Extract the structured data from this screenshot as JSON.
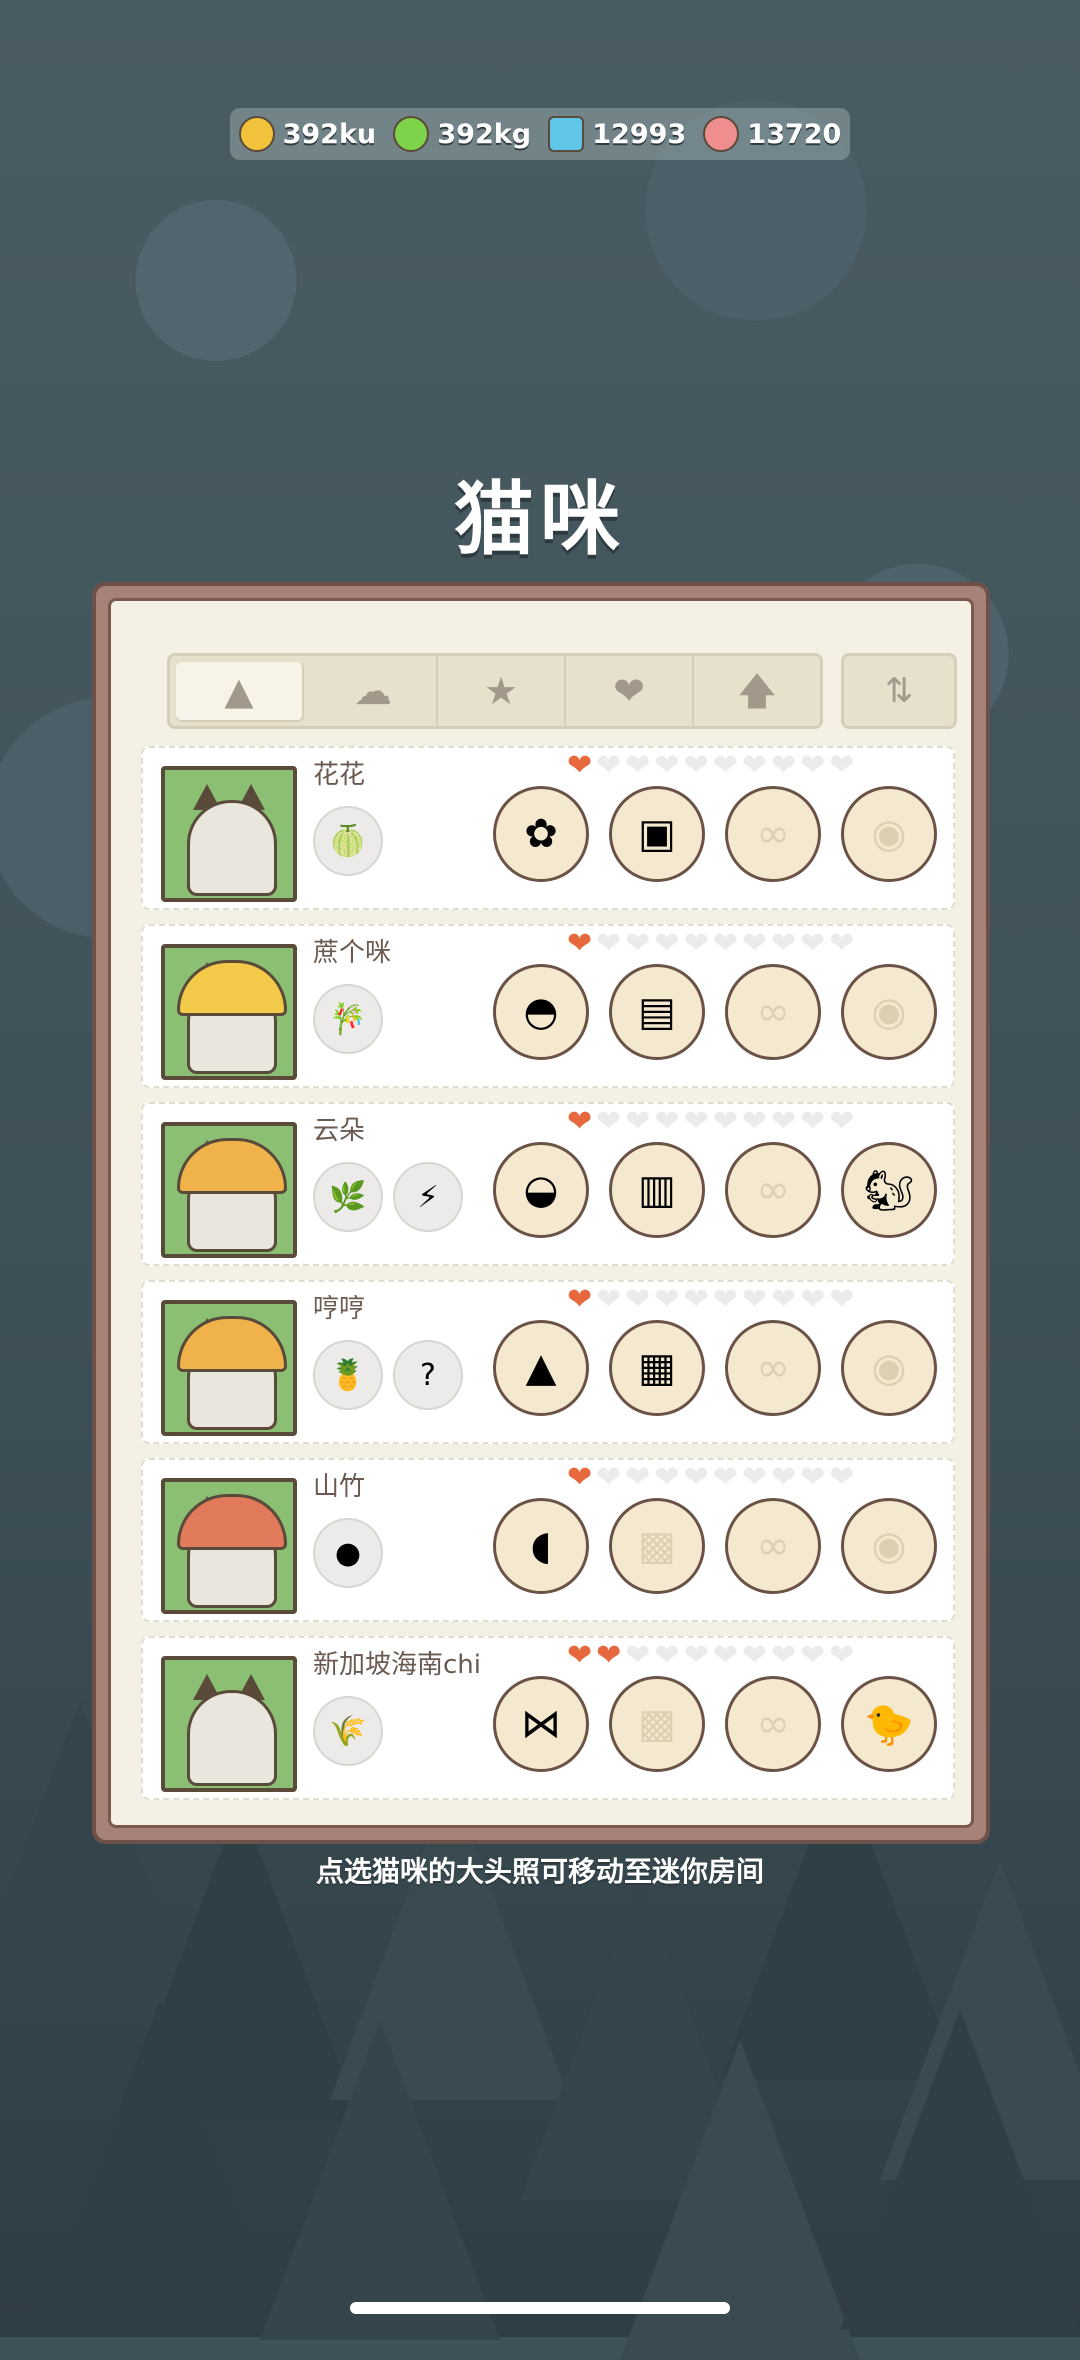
{
  "currency": [
    {
      "icon": "coin-icon",
      "value": "392ku",
      "color": "#f2c23c"
    },
    {
      "icon": "energy-icon",
      "value": "392kg",
      "color": "#7fd34b"
    },
    {
      "icon": "gem-icon",
      "value": "12993",
      "color": "#5fc6e8"
    },
    {
      "icon": "candy-icon",
      "value": "13720",
      "color": "#ef8e8e"
    }
  ],
  "title": "猫咪",
  "tabs": [
    {
      "icon": "cat-icon",
      "active": true
    },
    {
      "icon": "chef-hat-icon",
      "active": false
    },
    {
      "icon": "star-icon",
      "active": false
    },
    {
      "icon": "heart-icon",
      "active": false
    },
    {
      "icon": "arrow-up-icon",
      "active": false
    }
  ],
  "sort_icon": "sort-icon",
  "cats": [
    {
      "name": "花花",
      "hearts": 1,
      "skills": [
        "papaya-icon"
      ],
      "items": [
        "flower-icon",
        "vest-icon",
        "glasses-empty-icon",
        "pet-empty-icon"
      ]
    },
    {
      "name": "蔗个咪",
      "hearts": 1,
      "skills": [
        "sugarcane-icon"
      ],
      "items": [
        "cap-icon",
        "fish-shirt-icon",
        "glasses-empty-icon",
        "pet-empty-icon"
      ]
    },
    {
      "name": "云朵",
      "hearts": 1,
      "skills": [
        "herb-icon",
        "energy-icon"
      ],
      "items": [
        "sun-hat-icon",
        "top-icon",
        "glasses-empty-icon",
        "squirrel-icon"
      ]
    },
    {
      "name": "哼哼",
      "hearts": 1,
      "skills": [
        "pineapple-icon",
        "mystery-icon"
      ],
      "items": [
        "straw-hat-icon",
        "jacket-icon",
        "glasses-empty-icon",
        "pet-empty-icon"
      ]
    },
    {
      "name": "山竹",
      "hearts": 1,
      "skills": [
        "mangosteen-icon"
      ],
      "items": [
        "hood-icon",
        "shirt-empty-icon",
        "glasses-empty-icon",
        "pet-empty-icon"
      ]
    },
    {
      "name": "新加坡海南chi",
      "hearts": 2,
      "skills": [
        "wheat-icon"
      ],
      "items": [
        "bow-icon",
        "shirt-empty-icon",
        "glasses-empty-icon",
        "bird-icon"
      ]
    }
  ],
  "max_hearts": 10,
  "hint": "点选猫咪的大头照可移动至迷你房间"
}
